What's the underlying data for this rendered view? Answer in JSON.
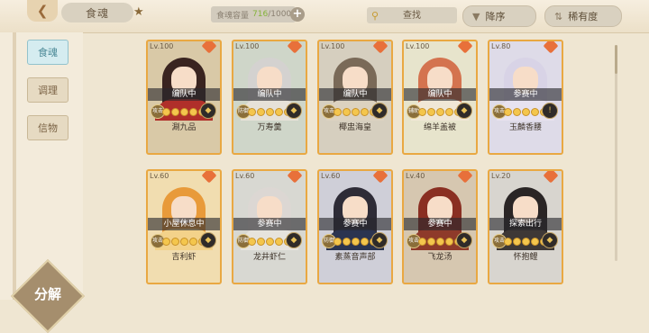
{
  "header": {
    "title": "食魂",
    "capacity_label": "食魂容量",
    "capacity_used": "716",
    "capacity_total": "/1000",
    "search_placeholder": "查找",
    "sort_desc_label": "降序",
    "sort_rarity_label": "稀有度"
  },
  "sidebar": {
    "items": [
      {
        "label": "食魂",
        "active": true
      },
      {
        "label": "调理",
        "active": false
      },
      {
        "label": "信物",
        "active": false
      }
    ],
    "decompose_label": "分解"
  },
  "colors": {
    "accent_gold": "#e9a842",
    "active_tab": "#92c2cc",
    "badge_orange": "#e8703a"
  },
  "cards": [
    {
      "level": "Lv.100",
      "status": "编队中",
      "name": "涮九品",
      "tag": "攻击",
      "stars": 5,
      "skill": "◆",
      "hair": "#3a2420",
      "robe": "#b02f2a",
      "bg": "#d9c9a7"
    },
    {
      "level": "Lv.100",
      "status": "编队中",
      "name": "万寿羹",
      "tag": "防御",
      "stars": 5,
      "skill": "◆",
      "hair": "#d4d2d0",
      "robe": "#e6e1d8",
      "bg": "#cfd6c9"
    },
    {
      "level": "Lv.100",
      "status": "编队中",
      "name": "椰盅海皇",
      "tag": "攻击",
      "stars": 5,
      "skill": "◆",
      "hair": "#7a6a58",
      "robe": "#dcd2c0",
      "bg": "#d6cfbf"
    },
    {
      "level": "Lv.100",
      "status": "编队中",
      "name": "绵羊盖被",
      "tag": "辅助",
      "stars": 5,
      "skill": "◆",
      "hair": "#d4734f",
      "robe": "#f0e7d6",
      "bg": "#e7e4cc"
    },
    {
      "level": "Lv.80",
      "status": "参赛中",
      "name": "玉麟香腰",
      "tag": "攻击",
      "stars": 5,
      "skill": "!",
      "hair": "#d8d3e6",
      "robe": "#e7e2ef",
      "bg": "#dedbe8"
    },
    {
      "level": "Lv.60",
      "status": "小屋休息中",
      "name": "吉利虾",
      "tag": "攻击",
      "stars": 5,
      "skill": "◆",
      "hair": "#e89a3a",
      "robe": "#f3d28a",
      "bg": "#f1ddb0"
    },
    {
      "level": "Lv.60",
      "status": "参赛中",
      "name": "龙井虾仁",
      "tag": "防御",
      "stars": 5,
      "skill": "◆",
      "hair": "#dcd7d3",
      "robe": "#e6e3dd",
      "bg": "#d8d8d2"
    },
    {
      "level": "Lv.60",
      "status": "参赛中",
      "name": "素蒸音声部",
      "tag": "防御",
      "stars": 5,
      "skill": "◆",
      "hair": "#2e2c37",
      "robe": "#2b3450",
      "bg": "#cfcfd8"
    },
    {
      "level": "Lv.40",
      "status": "参赛中",
      "name": "飞龙汤",
      "tag": "攻击",
      "stars": 5,
      "skill": "◆",
      "hair": "#8a2f22",
      "robe": "#8e3a2a",
      "bg": "#d6c7b0"
    },
    {
      "level": "Lv.20",
      "status": "探索出行",
      "name": "怀抱鲤",
      "tag": "攻击",
      "stars": 5,
      "skill": "◆",
      "hair": "#2a2525",
      "robe": "#3e3836",
      "bg": "#d8d5cf"
    }
  ]
}
